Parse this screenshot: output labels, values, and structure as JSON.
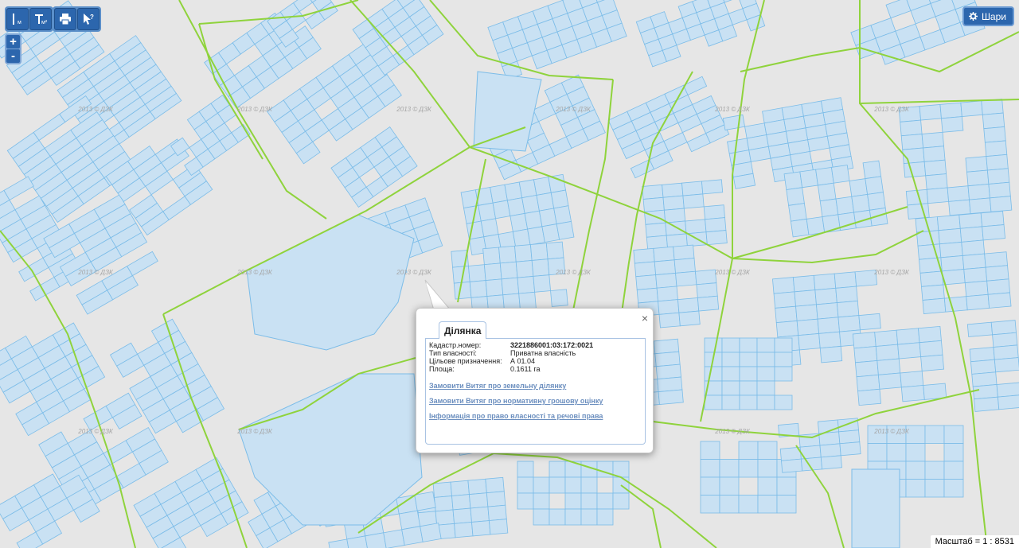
{
  "toolbar": {
    "left_tools": [
      "measure-distance-icon",
      "measure-area-icon"
    ],
    "right_tools": [
      "print-icon",
      "info-cursor-icon"
    ],
    "distance_sub": "м",
    "area_sub": "м²"
  },
  "zoom": {
    "plus": "+",
    "minus": "-"
  },
  "layers_button": {
    "label": "Шари"
  },
  "scale": {
    "label": "Масштаб = 1 : 8531"
  },
  "watermark": "2013 © ДЗК",
  "popup": {
    "tab": "Ділянка",
    "close": "×",
    "fields": [
      {
        "label": "Кадастр.номер:",
        "value": "3221886001:03:172:0021"
      },
      {
        "label": "Тип власності:",
        "value": "Приватна власність"
      },
      {
        "label": "Цільове призначення:",
        "value": "А 01.04"
      },
      {
        "label": "Площа:",
        "value": "0.1611 га"
      }
    ],
    "links": [
      "Замовити Витяг про земельну ділянку",
      "Замовити Витяг про нормативну грошову оцінку",
      "Інформація про право власності та речові права"
    ]
  },
  "colors": {
    "background": "#e6e6e6",
    "parcel_fill": "#c9e1f3",
    "parcel_stroke": "#7bbce8",
    "boundary": "#8fd33c",
    "button": "#2c66ad"
  }
}
